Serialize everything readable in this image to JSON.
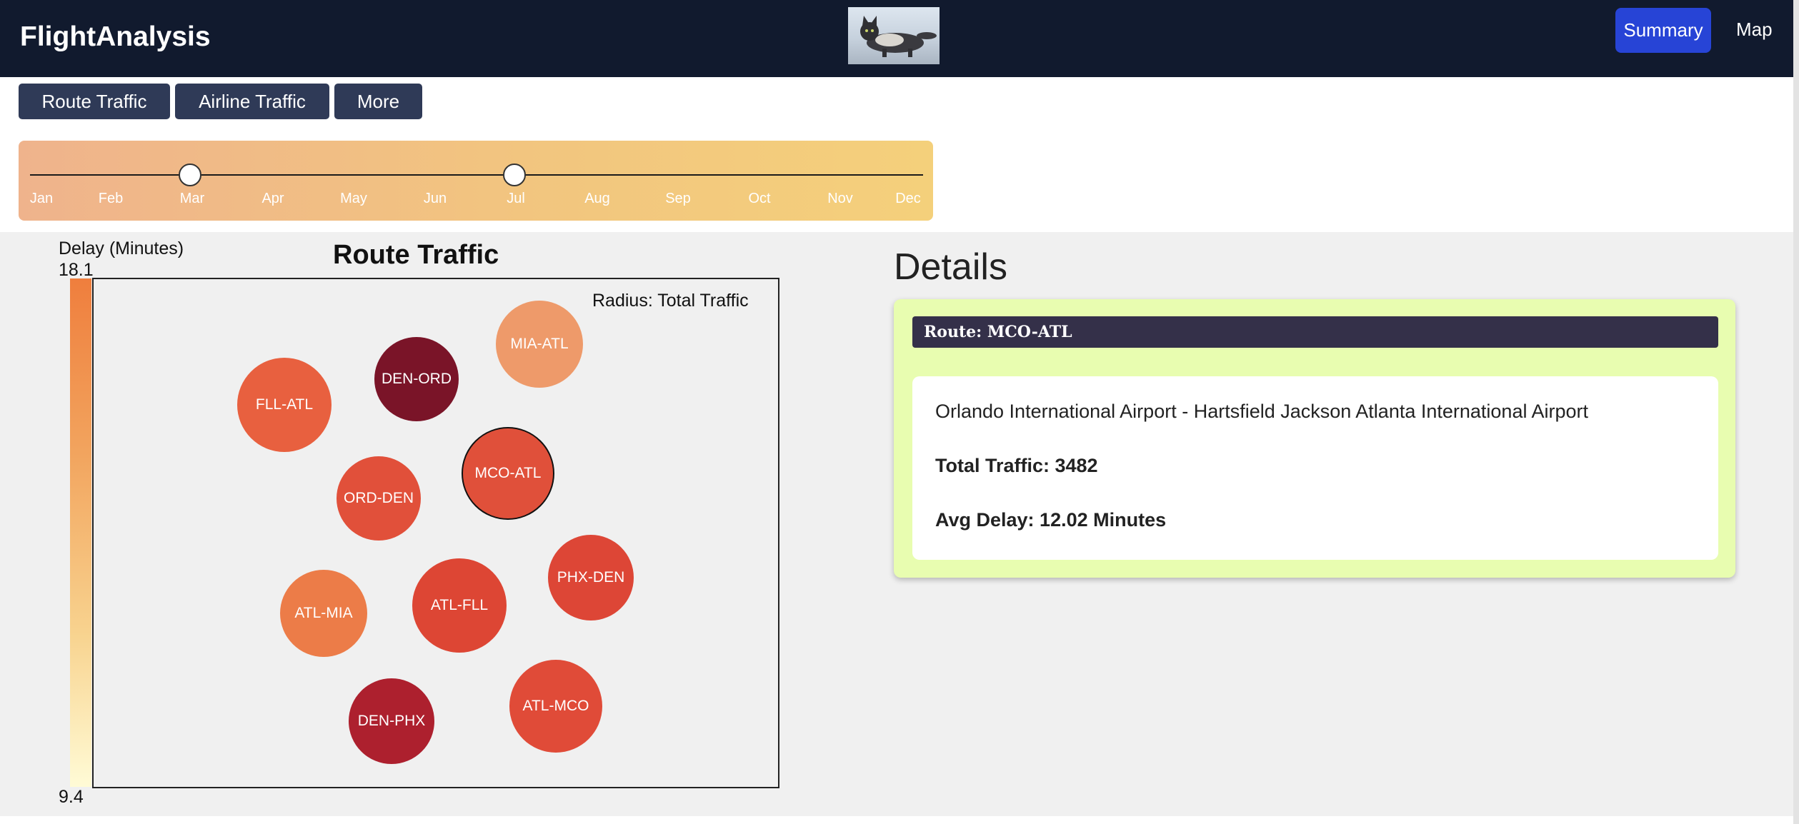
{
  "navbar": {
    "brand": "FlightAnalysis",
    "summary_label": "Summary",
    "map_label": "Map"
  },
  "tabs": [
    {
      "label": "Route Traffic"
    },
    {
      "label": "Airline Traffic"
    },
    {
      "label": "More"
    }
  ],
  "month_slider": {
    "months": [
      "Jan",
      "Feb",
      "Mar",
      "Apr",
      "May",
      "Jun",
      "Jul",
      "Aug",
      "Sep",
      "Oct",
      "Nov",
      "Dec"
    ],
    "range_start": "Mar",
    "range_end": "Jul"
  },
  "chart": {
    "title": "Route Traffic",
    "legend_title": "Delay (Minutes)",
    "legend_max": "18.1",
    "legend_min": "9.4",
    "radius_label": "Radius: Total Traffic",
    "colors": {
      "low": "#fffbd6",
      "mid": "#f2a55f",
      "high": "#ef7e3d"
    }
  },
  "chart_data": {
    "type": "scatter",
    "title": "Route Traffic",
    "color_scale": {
      "label": "Delay (Minutes)",
      "min": 9.4,
      "max": 18.1
    },
    "size_encoding": "Total Traffic",
    "points": [
      {
        "label": "MIA-ATL",
        "color": "#ee9a6a"
      },
      {
        "label": "DEN-ORD",
        "color": "#7a1428"
      },
      {
        "label": "FLL-ATL",
        "color": "#e8603f"
      },
      {
        "label": "MCO-ATL",
        "color": "#e0503a",
        "selected": true
      },
      {
        "label": "ORD-DEN",
        "color": "#e1503a"
      },
      {
        "label": "PHX-DEN",
        "color": "#dd4636"
      },
      {
        "label": "ATL-FLL",
        "color": "#dd4634"
      },
      {
        "label": "ATL-MIA",
        "color": "#ec7c48"
      },
      {
        "label": "ATL-MCO",
        "color": "#e04b38"
      },
      {
        "label": "DEN-PHX",
        "color": "#ad202e"
      }
    ]
  },
  "details": {
    "heading": "Details",
    "route_label": "Route: MCO-ATL",
    "airports": "Orlando International Airport - Hartsfield Jackson Atlanta International Airport",
    "total_traffic": "Total Traffic: 3482",
    "avg_delay": "Avg Delay: 12.02 Minutes"
  }
}
